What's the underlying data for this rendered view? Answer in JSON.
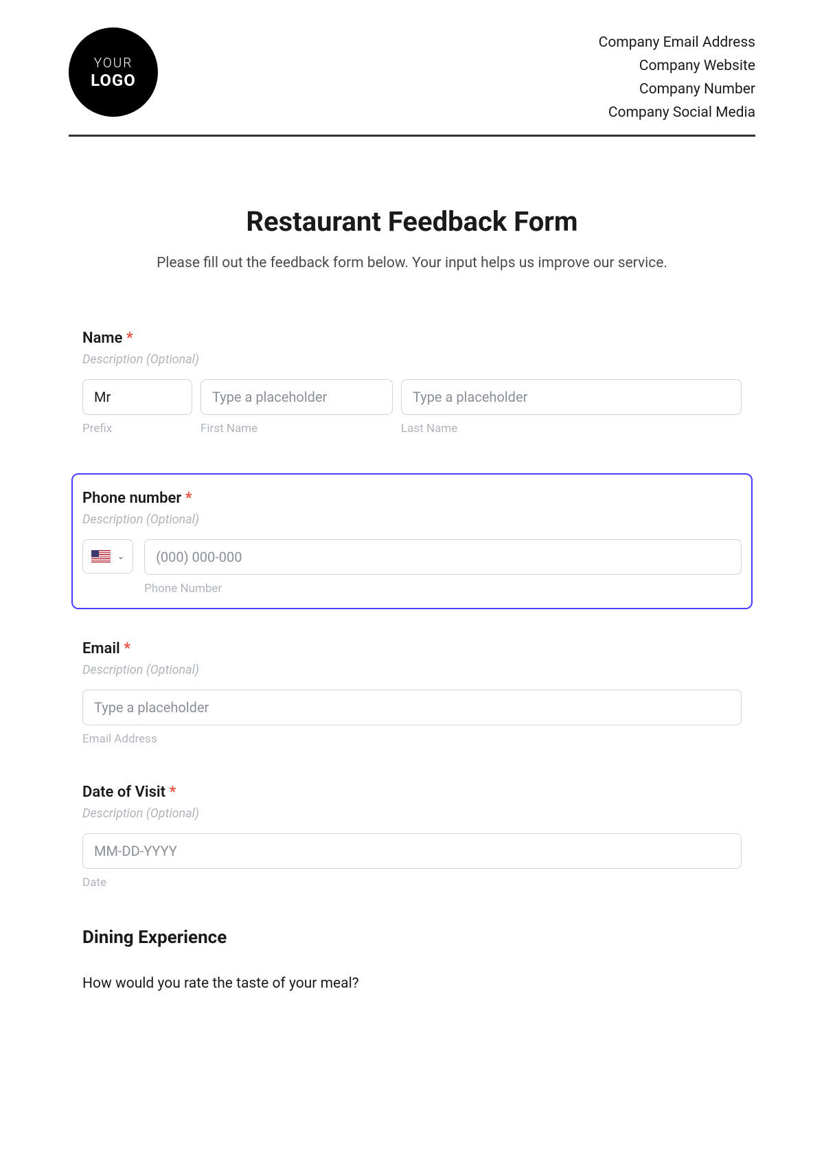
{
  "header": {
    "logo": {
      "line1": "YOUR",
      "line2": "LOGO"
    },
    "company": {
      "email": "Company Email Address",
      "website": "Company Website",
      "number": "Company Number",
      "social": "Company Social Media"
    }
  },
  "form": {
    "title": "Restaurant Feedback Form",
    "subtitle": "Please fill out the feedback form below. Your input helps us improve our service.",
    "description_placeholder": "Description (Optional)",
    "name": {
      "label": "Name",
      "prefix_value": "Mr",
      "prefix_sublabel": "Prefix",
      "firstname_placeholder": "Type a placeholder",
      "firstname_sublabel": "First Name",
      "lastname_placeholder": "Type a placeholder",
      "lastname_sublabel": "Last Name"
    },
    "phone": {
      "label": "Phone number",
      "placeholder": "(000) 000-000",
      "sublabel": "Phone Number"
    },
    "email": {
      "label": "Email",
      "placeholder": "Type a placeholder",
      "sublabel": "Email Address"
    },
    "date": {
      "label": "Date of Visit",
      "placeholder": "MM-DD-YYYY",
      "sublabel": "Date"
    },
    "section_heading": "Dining Experience",
    "question1": "How would you rate the taste of your meal?"
  }
}
